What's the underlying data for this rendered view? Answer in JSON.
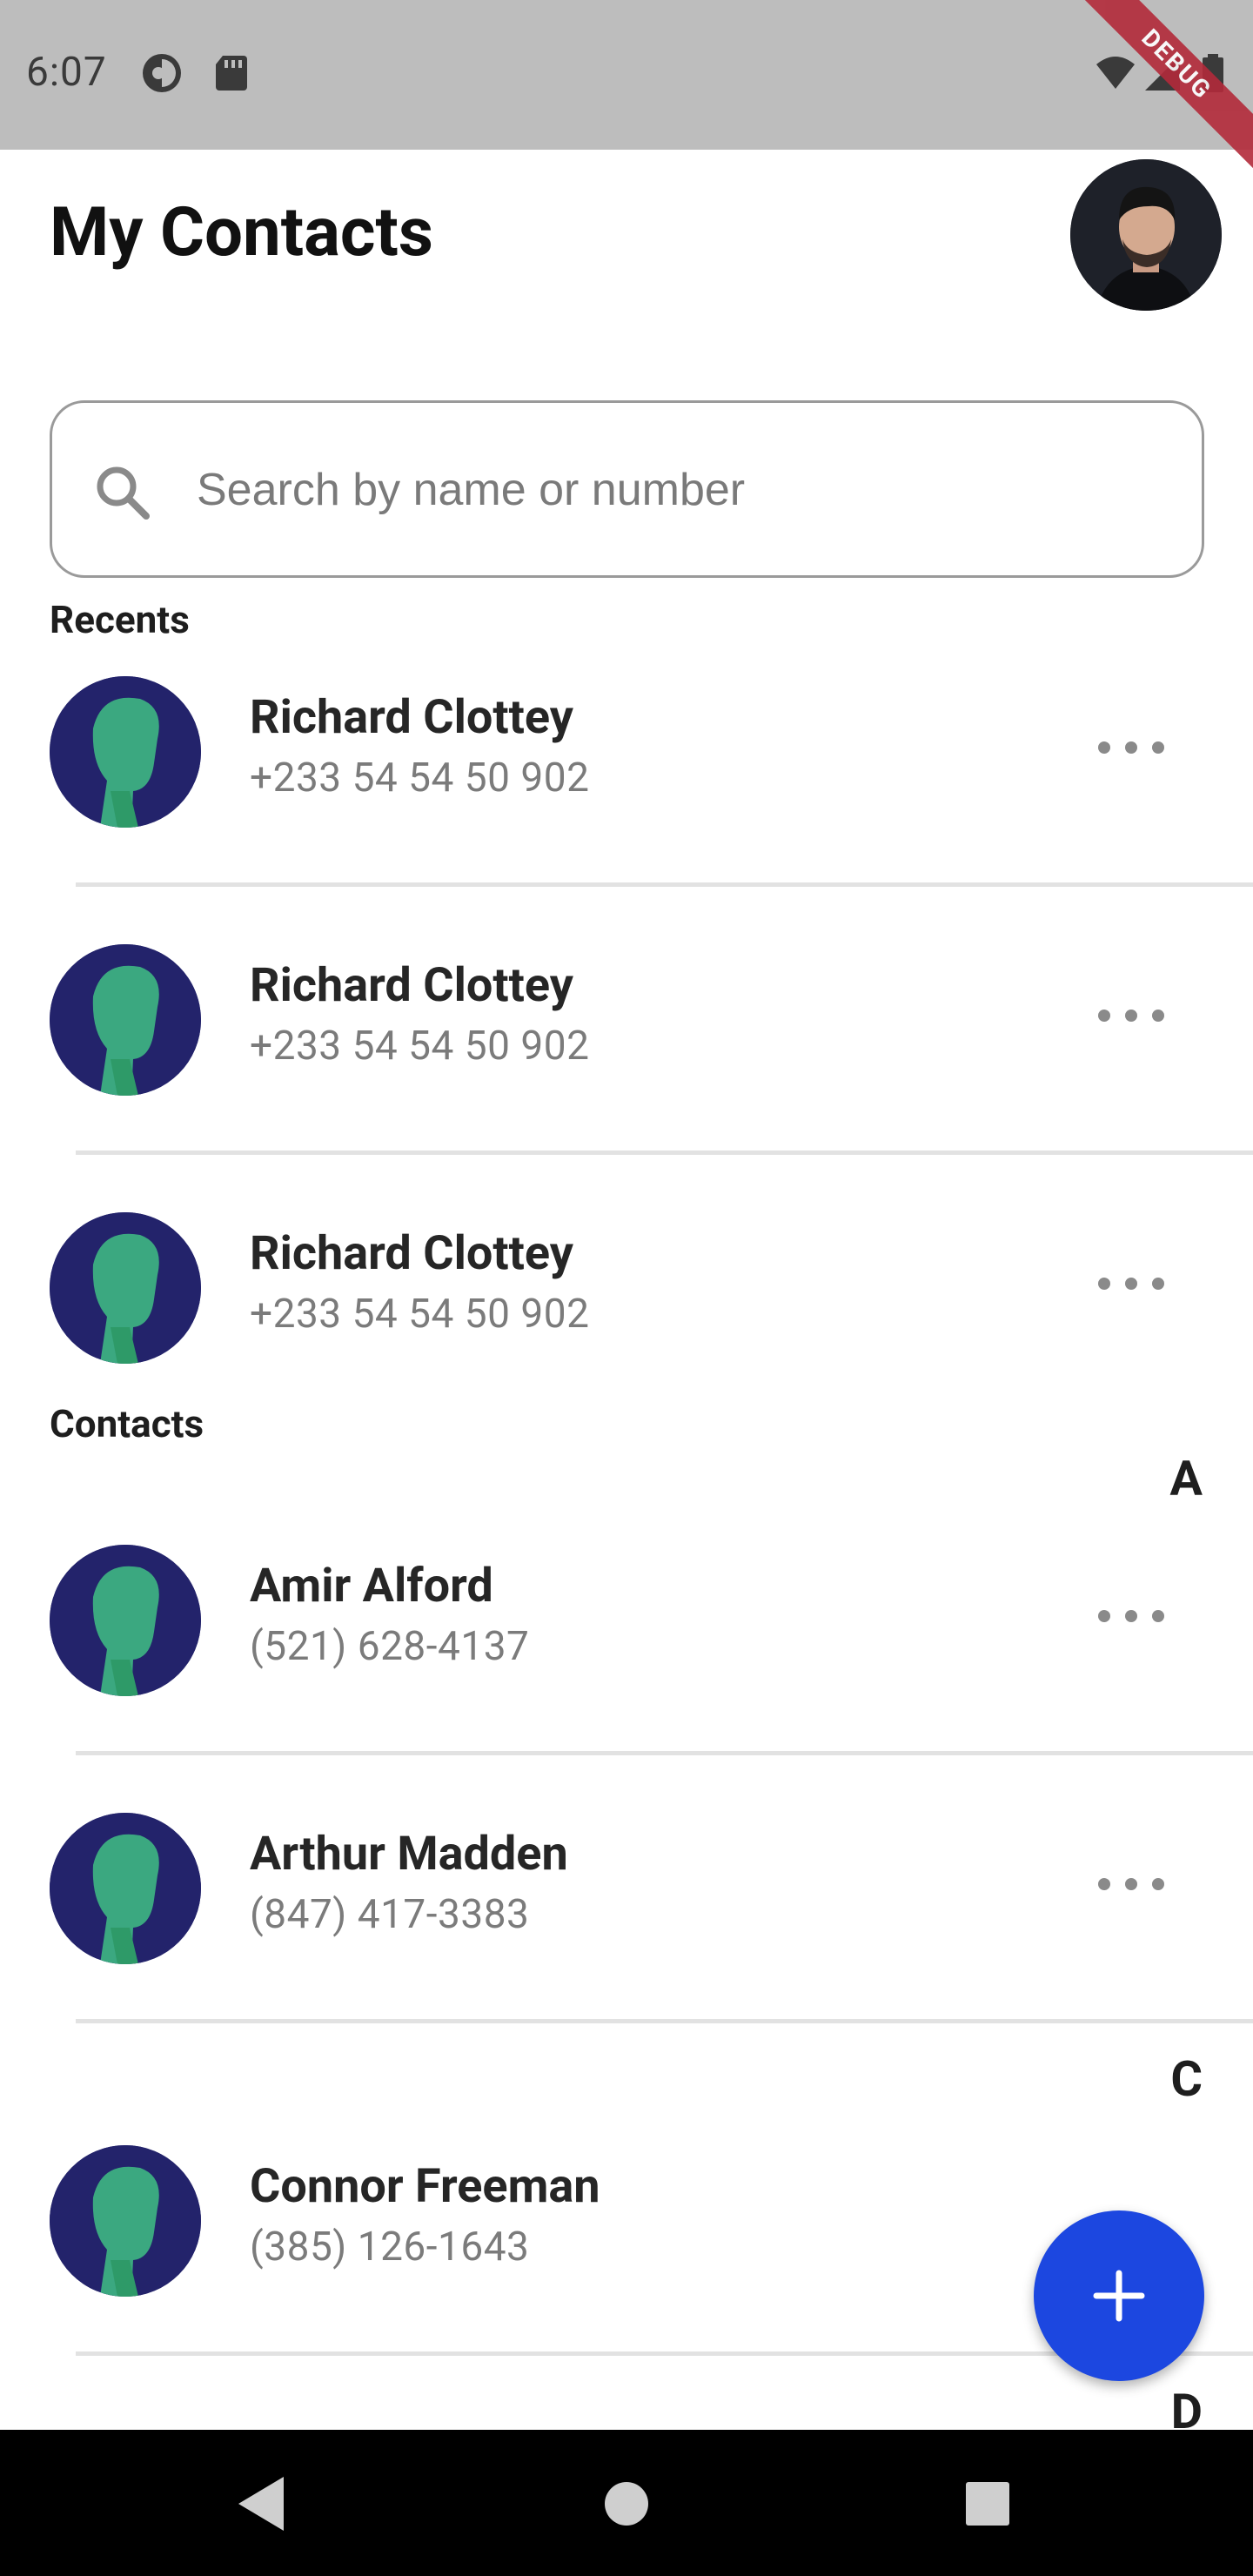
{
  "status_bar": {
    "time": "6:07",
    "debug_label": "DEBUG",
    "icons": [
      "circle-half-icon",
      "sd-card-icon",
      "wifi-icon",
      "signal-icon",
      "battery-icon"
    ]
  },
  "header": {
    "title": "My Contacts",
    "profile_avatar": "profile-photo"
  },
  "search": {
    "placeholder": "Search by name or number",
    "value": ""
  },
  "recents": {
    "label": "Recents",
    "items": [
      {
        "name": "Richard Clottey",
        "phone": "+233 54 54 50 902"
      },
      {
        "name": "Richard Clottey",
        "phone": "+233 54 54 50 902"
      },
      {
        "name": "Richard Clottey",
        "phone": "+233 54 54 50 902"
      }
    ]
  },
  "contacts": {
    "label": "Contacts",
    "groups": [
      {
        "letter": "A",
        "items": [
          {
            "name": "Amir Alford",
            "phone": "(521) 628-4137"
          },
          {
            "name": "Arthur Madden",
            "phone": "(847) 417-3383"
          }
        ]
      },
      {
        "letter": "C",
        "items": [
          {
            "name": "Connor Freeman",
            "phone": "(385) 126-1643"
          }
        ]
      },
      {
        "letter": "D",
        "items": []
      }
    ]
  },
  "fab": {
    "icon": "plus-icon",
    "color": "#1c47e0"
  },
  "colors": {
    "avatar_bg": "#23236b",
    "avatar_accent": "#3fbf84",
    "status_bar": "#bdbdbd",
    "debug_banner": "#b22a3a"
  },
  "nav_bar": {
    "icons": [
      "back-icon",
      "home-icon",
      "recents-icon"
    ]
  }
}
